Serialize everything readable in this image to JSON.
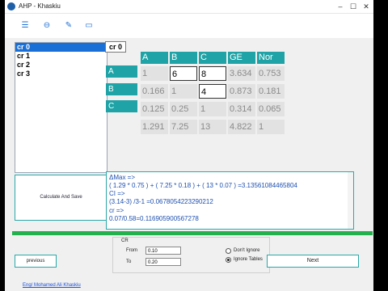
{
  "window": {
    "title": "AHP - Khaskiu"
  },
  "toolbar": {
    "icons": [
      "menu-icon",
      "view-icon",
      "edit-icon",
      "monitor-icon"
    ]
  },
  "list": {
    "items": [
      "cr 0",
      "cr 1",
      "cr 2",
      "cr 3"
    ],
    "selected_index": 0
  },
  "badge": "cr 0",
  "table": {
    "headers": [
      "A",
      "B",
      "C",
      "GE",
      "Nor"
    ],
    "row_labels": [
      "A",
      "B",
      "C"
    ],
    "rows": [
      [
        "1",
        "6",
        "8",
        "3.634",
        "0.753"
      ],
      [
        "0.166",
        "1",
        "4",
        "0.873",
        "0.181"
      ],
      [
        "0.125",
        "0.25",
        "1",
        "0.314",
        "0.065"
      ],
      [
        "1.291",
        "7.25",
        "13",
        "4.822",
        "1"
      ]
    ]
  },
  "calc_button": "Calculate And Save",
  "output": {
    "lines": [
      "ΔMax =>",
      "( 1.29 * 0.75 )  + ( 7.25 * 0.18 )  + ( 13 * 0.07 )  =3.13561084465804",
      "CI =>",
      "(3.14-3) /3-1 =0.0678054223290212",
      "cr =>",
      "0.07/0.58=0.116905900567278"
    ]
  },
  "cr_group": {
    "label": "CR",
    "from_label": "From",
    "from_value": "0.10",
    "to_label": "To",
    "to_value": "0.20",
    "radio_options": [
      "Don't Ignore",
      "Ignore Tables"
    ],
    "radio_selected": 1
  },
  "buttons": {
    "previous": "previous",
    "next": "Next"
  },
  "credit": "Eng/ Mohamed Ali Khaskiu"
}
